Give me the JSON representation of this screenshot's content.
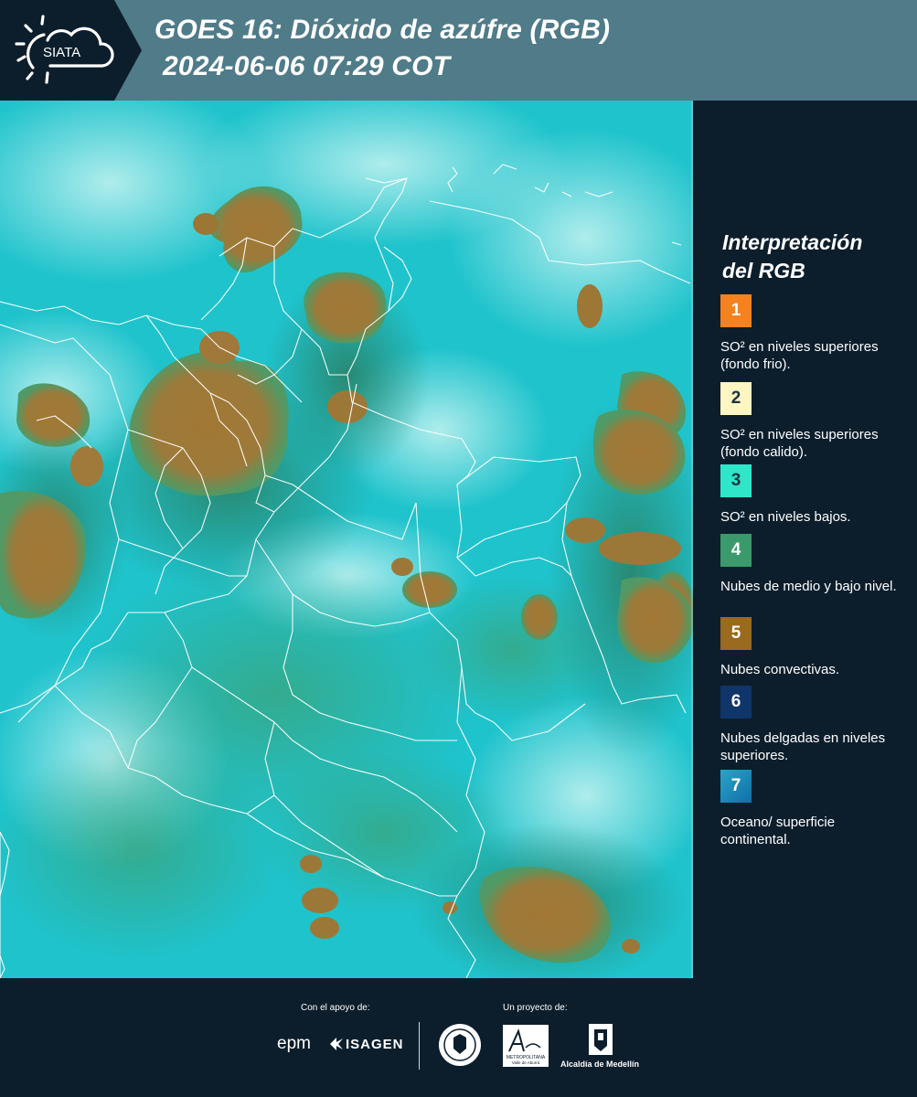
{
  "header": {
    "logo_text": "SIATA",
    "title_line1": "GOES 16: Dióxido de azúfre (RGB)",
    "title_line2": "2024-06-06 07:29 COT"
  },
  "legend": {
    "title_line1": "Interpretación",
    "title_line2": "del RGB",
    "items": [
      {
        "number": "1",
        "label": "SO² en niveles superiores (fondo frio).",
        "color": "#f5821f",
        "text_color": "#ffffff"
      },
      {
        "number": "2",
        "label": "SO² en niveles superiores (fondo calido).",
        "color": "#fdf6c3",
        "text_color": "#1c3342"
      },
      {
        "number": "3",
        "label": "SO² en niveles bajos.",
        "color": "#2fe6c8",
        "text_color": "#1c3342"
      },
      {
        "number": "4",
        "label": "Nubes de medio y bajo nivel.",
        "color": "#3a9a6c",
        "text_color": "#ffffff"
      },
      {
        "number": "5",
        "label": "Nubes convectivas.",
        "color": "#9a6a1e",
        "text_color": "#ffffff"
      },
      {
        "number": "6",
        "label": "Nubes delgadas en niveles superiores.",
        "color": "#0f3569",
        "text_color": "#ffffff"
      },
      {
        "number": "7",
        "label": "Oceano/ superficie continental.",
        "color": "#1c8fbf",
        "text_color": "#ffffff"
      }
    ]
  },
  "footer": {
    "support_label": "Con el apoyo de:",
    "project_label": "Un proyecto de:",
    "sponsors": [
      "epm",
      "ISAGEN"
    ],
    "partners": [
      "Área Metropolitana Valle de Aburrá",
      "Alcaldía de Medellín"
    ],
    "partner_caption_area_line1": "METROPOLITANA",
    "partner_caption_area_line2": "Valle de Aburrá",
    "partner_caption_alcaldia": "Alcaldía de Medellín"
  },
  "map": {
    "colors": {
      "background": "#22c4cf",
      "convective": "#a57a32",
      "low_clouds": "#3f9f74",
      "border": "#ffffff"
    }
  }
}
